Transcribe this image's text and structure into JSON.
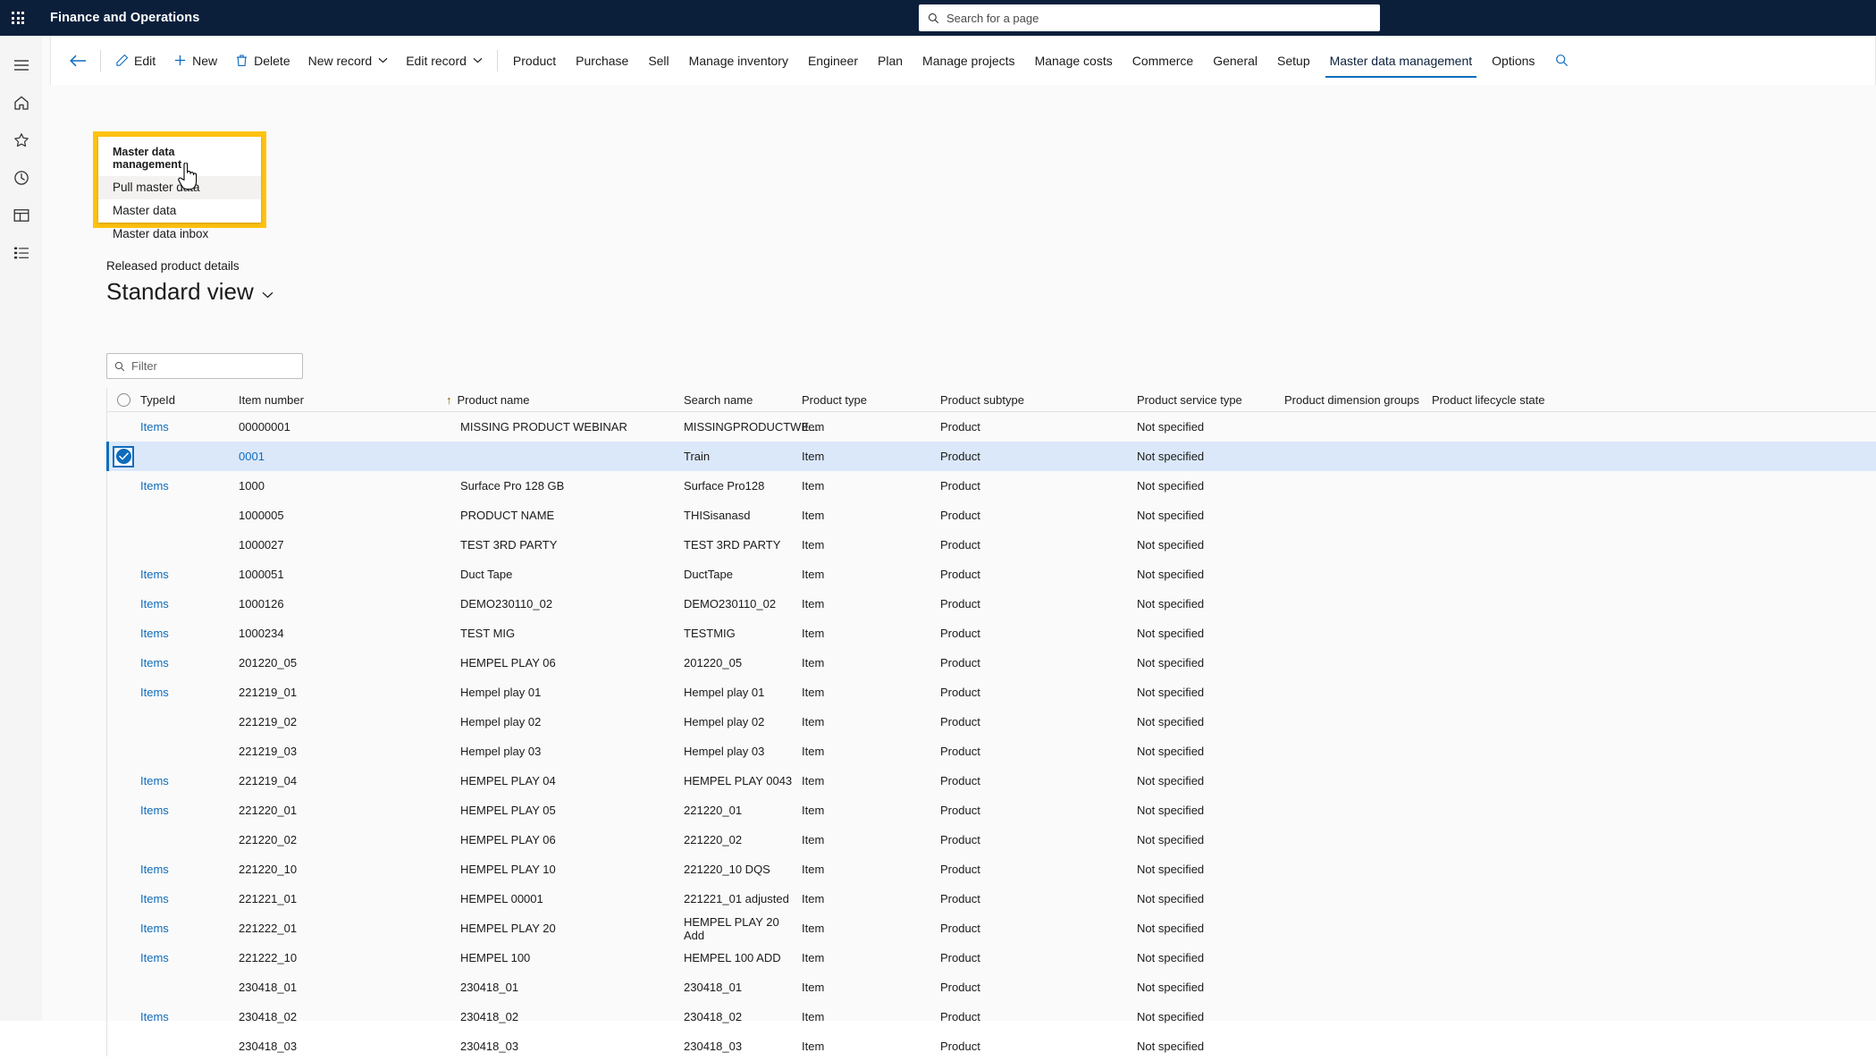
{
  "topbar": {
    "waffle_icon": "app-launcher-icon",
    "app_title": "Finance and Operations",
    "search": {
      "icon": "search-icon",
      "placeholder": "Search for a page",
      "value": ""
    }
  },
  "rail": {
    "items": [
      {
        "icon": "hamburger-icon",
        "name": "nav-menu"
      },
      {
        "icon": "home-icon",
        "name": "home"
      },
      {
        "icon": "star-icon",
        "name": "favorites"
      },
      {
        "icon": "clock-icon",
        "name": "recent"
      },
      {
        "icon": "workspaces-icon",
        "name": "workspaces"
      },
      {
        "icon": "modules-icon",
        "name": "modules"
      }
    ]
  },
  "ribbon": {
    "back_icon": "back-arrow-icon",
    "commands": [
      {
        "label": "Edit",
        "icon": "pencil-icon"
      },
      {
        "label": "New",
        "icon": "plus-icon"
      },
      {
        "label": "Delete",
        "icon": "trash-icon"
      },
      {
        "label": "New record",
        "icon": "chevron-down-icon"
      },
      {
        "label": "Edit record",
        "icon": "chevron-down-icon"
      }
    ],
    "tabs": [
      {
        "label": "Product",
        "active": false
      },
      {
        "label": "Purchase",
        "active": false
      },
      {
        "label": "Sell",
        "active": false
      },
      {
        "label": "Manage inventory",
        "active": false
      },
      {
        "label": "Engineer",
        "active": false
      },
      {
        "label": "Plan",
        "active": false
      },
      {
        "label": "Manage projects",
        "active": false
      },
      {
        "label": "Manage costs",
        "active": false
      },
      {
        "label": "Commerce",
        "active": false
      },
      {
        "label": "General",
        "active": false
      },
      {
        "label": "Setup",
        "active": false
      },
      {
        "label": "Master data management",
        "active": true
      },
      {
        "label": "Options",
        "active": false
      }
    ],
    "search_icon": "ribbon-search-icon"
  },
  "flyout": {
    "title": "Master data management",
    "items": [
      {
        "label": "Pull master data",
        "highlighted": true
      },
      {
        "label": "Master data",
        "highlighted": false
      },
      {
        "label": "Master data inbox",
        "highlighted": false
      }
    ],
    "highlight_color": "#ffc20e"
  },
  "page": {
    "breadcrumb": "Released product details",
    "view_title": "Standard view",
    "view_caret_icon": "chevron-down-icon"
  },
  "filter": {
    "icon": "search-icon",
    "placeholder": "Filter",
    "value": ""
  },
  "grid": {
    "select_all_icon": "select-all-circle-icon",
    "sort_indicator": "↑",
    "sort_column": "Product name",
    "columns": [
      "TypeId",
      "Item number",
      "Product name",
      "Search name",
      "Product type",
      "Product subtype",
      "Product service type",
      "Product dimension groups",
      "Product lifecycle state"
    ],
    "rows": [
      {
        "selected": false,
        "typeid": "Items",
        "item_number": "00000001",
        "product_name": "MISSING PRODUCT WEBINAR",
        "search_name": "MISSINGPRODUCTWE...",
        "product_type": "Item",
        "product_subtype": "Product",
        "product_service_type": "Not specified",
        "product_dimension_groups": "",
        "product_lifecycle_state": ""
      },
      {
        "selected": true,
        "typeid": "",
        "item_number": "0001",
        "product_name": "",
        "search_name": "Train",
        "product_type": "Item",
        "product_subtype": "Product",
        "product_service_type": "Not specified",
        "product_dimension_groups": "",
        "product_lifecycle_state": ""
      },
      {
        "selected": false,
        "typeid": "Items",
        "item_number": "1000",
        "product_name": "Surface Pro 128 GB",
        "search_name": "Surface Pro128",
        "product_type": "Item",
        "product_subtype": "Product",
        "product_service_type": "Not specified",
        "product_dimension_groups": "",
        "product_lifecycle_state": ""
      },
      {
        "selected": false,
        "typeid": "",
        "item_number": "1000005",
        "product_name": "PRODUCT NAME",
        "search_name": "THISisanasd",
        "product_type": "Item",
        "product_subtype": "Product",
        "product_service_type": "Not specified",
        "product_dimension_groups": "",
        "product_lifecycle_state": ""
      },
      {
        "selected": false,
        "typeid": "",
        "item_number": "1000027",
        "product_name": "TEST 3RD PARTY",
        "search_name": "TEST 3RD PARTY",
        "product_type": "Item",
        "product_subtype": "Product",
        "product_service_type": "Not specified",
        "product_dimension_groups": "",
        "product_lifecycle_state": ""
      },
      {
        "selected": false,
        "typeid": "Items",
        "item_number": "1000051",
        "product_name": "Duct Tape",
        "search_name": "DuctTape",
        "product_type": "Item",
        "product_subtype": "Product",
        "product_service_type": "Not specified",
        "product_dimension_groups": "",
        "product_lifecycle_state": ""
      },
      {
        "selected": false,
        "typeid": "Items",
        "item_number": "1000126",
        "product_name": "DEMO230110_02",
        "search_name": "DEMO230110_02",
        "product_type": "Item",
        "product_subtype": "Product",
        "product_service_type": "Not specified",
        "product_dimension_groups": "",
        "product_lifecycle_state": ""
      },
      {
        "selected": false,
        "typeid": "Items",
        "item_number": "1000234",
        "product_name": "TEST MIG",
        "search_name": "TESTMIG",
        "product_type": "Item",
        "product_subtype": "Product",
        "product_service_type": "Not specified",
        "product_dimension_groups": "",
        "product_lifecycle_state": ""
      },
      {
        "selected": false,
        "typeid": "Items",
        "item_number": "201220_05",
        "product_name": "HEMPEL PLAY 06",
        "search_name": "201220_05",
        "product_type": "Item",
        "product_subtype": "Product",
        "product_service_type": "Not specified",
        "product_dimension_groups": "",
        "product_lifecycle_state": ""
      },
      {
        "selected": false,
        "typeid": "Items",
        "item_number": "221219_01",
        "product_name": "Hempel play 01",
        "search_name": "Hempel play 01",
        "product_type": "Item",
        "product_subtype": "Product",
        "product_service_type": "Not specified",
        "product_dimension_groups": "",
        "product_lifecycle_state": ""
      },
      {
        "selected": false,
        "typeid": "",
        "item_number": "221219_02",
        "product_name": "Hempel play 02",
        "search_name": "Hempel play 02",
        "product_type": "Item",
        "product_subtype": "Product",
        "product_service_type": "Not specified",
        "product_dimension_groups": "",
        "product_lifecycle_state": ""
      },
      {
        "selected": false,
        "typeid": "",
        "item_number": "221219_03",
        "product_name": "Hempel play 03",
        "search_name": "Hempel play 03",
        "product_type": "Item",
        "product_subtype": "Product",
        "product_service_type": "Not specified",
        "product_dimension_groups": "",
        "product_lifecycle_state": ""
      },
      {
        "selected": false,
        "typeid": "Items",
        "item_number": "221219_04",
        "product_name": "HEMPEL PLAY 04",
        "search_name": "HEMPEL PLAY 0043",
        "product_type": "Item",
        "product_subtype": "Product",
        "product_service_type": "Not specified",
        "product_dimension_groups": "",
        "product_lifecycle_state": ""
      },
      {
        "selected": false,
        "typeid": "Items",
        "item_number": "221220_01",
        "product_name": "HEMPEL PLAY 05",
        "search_name": "221220_01",
        "product_type": "Item",
        "product_subtype": "Product",
        "product_service_type": "Not specified",
        "product_dimension_groups": "",
        "product_lifecycle_state": ""
      },
      {
        "selected": false,
        "typeid": "",
        "item_number": "221220_02",
        "product_name": "HEMPEL PLAY 06",
        "search_name": "221220_02",
        "product_type": "Item",
        "product_subtype": "Product",
        "product_service_type": "Not specified",
        "product_dimension_groups": "",
        "product_lifecycle_state": ""
      },
      {
        "selected": false,
        "typeid": "Items",
        "item_number": "221220_10",
        "product_name": "HEMPEL PLAY 10",
        "search_name": "221220_10 DQS",
        "product_type": "Item",
        "product_subtype": "Product",
        "product_service_type": "Not specified",
        "product_dimension_groups": "",
        "product_lifecycle_state": ""
      },
      {
        "selected": false,
        "typeid": "Items",
        "item_number": "221221_01",
        "product_name": "HEMPEL 00001",
        "search_name": "221221_01 adjusted",
        "product_type": "Item",
        "product_subtype": "Product",
        "product_service_type": "Not specified",
        "product_dimension_groups": "",
        "product_lifecycle_state": ""
      },
      {
        "selected": false,
        "typeid": "Items",
        "item_number": "221222_01",
        "product_name": "HEMPEL PLAY 20",
        "search_name": "HEMPEL PLAY 20 Add",
        "product_type": "Item",
        "product_subtype": "Product",
        "product_service_type": "Not specified",
        "product_dimension_groups": "",
        "product_lifecycle_state": ""
      },
      {
        "selected": false,
        "typeid": "Items",
        "item_number": "221222_10",
        "product_name": "HEMPEL 100",
        "search_name": "HEMPEL 100 ADD",
        "product_type": "Item",
        "product_subtype": "Product",
        "product_service_type": "Not specified",
        "product_dimension_groups": "",
        "product_lifecycle_state": ""
      },
      {
        "selected": false,
        "typeid": "",
        "item_number": "230418_01",
        "product_name": "230418_01",
        "search_name": "230418_01",
        "product_type": "Item",
        "product_subtype": "Product",
        "product_service_type": "Not specified",
        "product_dimension_groups": "",
        "product_lifecycle_state": ""
      },
      {
        "selected": false,
        "typeid": "Items",
        "item_number": "230418_02",
        "product_name": "230418_02",
        "search_name": "230418_02",
        "product_type": "Item",
        "product_subtype": "Product",
        "product_service_type": "Not specified",
        "product_dimension_groups": "",
        "product_lifecycle_state": ""
      },
      {
        "selected": false,
        "typeid": "",
        "item_number": "230418_03",
        "product_name": "230418_03",
        "search_name": "230418_03",
        "product_type": "Item",
        "product_subtype": "Product",
        "product_service_type": "Not specified",
        "product_dimension_groups": "",
        "product_lifecycle_state": ""
      }
    ]
  },
  "colors": {
    "brand_navy": "#0b1f3b",
    "accent_blue": "#0f6cbd",
    "highlight_yellow": "#ffc20e",
    "selected_row": "#dbe8f9"
  }
}
